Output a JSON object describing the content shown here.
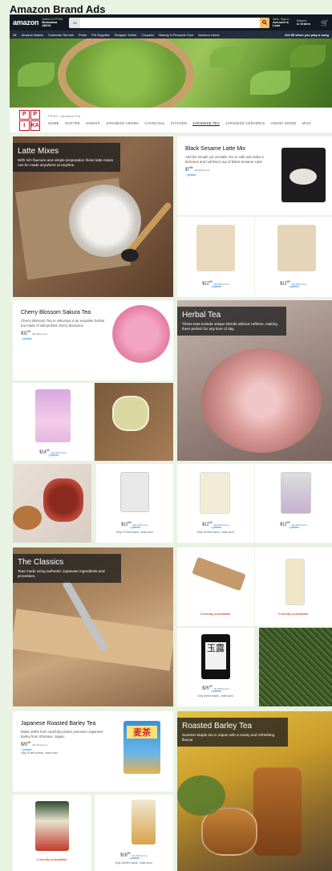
{
  "page_title": "Amazon Brand Ads",
  "header": {
    "logo": "amazon",
    "deliver_line1": "Deliver to PPIKA",
    "deliver_line2": "Botswana 48616",
    "search_dept": "All",
    "search_placeholder": "",
    "account_line1": "Hello, Sign in",
    "account_line2": "Account & Lists",
    "orders_line1": "Returns",
    "orders_line2": "& Orders"
  },
  "nav": {
    "items": [
      "All",
      "Amazon Basics",
      "Customer Service",
      "Prime",
      "Pet Supplies",
      "Shopper Toolkit",
      "Coupons",
      "Beauty & Personal Care",
      "Amazon Home"
    ],
    "promo": "Get $5 when you play a song"
  },
  "brand": {
    "logo_letters": [
      "P",
      "P",
      "I",
      "KA"
    ],
    "breadcrumb": "PPIKA › Japanese Tea",
    "tabs": [
      "HOME",
      "GOSTEE",
      "HAWAIP",
      "JAPANESE AROMA",
      "CHARCOAL",
      "KITCHEN",
      "JAPANESE TEA",
      "JAPANESE CERAMICS",
      "HINOKI WOOD",
      "MISC"
    ],
    "active_tab": 6
  },
  "sections": {
    "latte": {
      "title": "Latte Mixes",
      "desc": "With rich flavours and simple preparation these latte mixes can be made anywhere at anytime."
    },
    "herbal": {
      "title": "Herbal Tea",
      "desc": "These teas include unique blends without caffeine, making them perfect for any time of day."
    },
    "classics": {
      "title": "The Classics",
      "desc": "Teas made using authentic Japanese ingredients and processes."
    },
    "roasted": {
      "title": "Roasted Barley Tea",
      "desc": "Summer-staple tea in Japan with a roasty and refreshing flavour"
    }
  },
  "products": {
    "black_sesame": {
      "title": "Black Sesame Latte Mix",
      "desc": "Add the simple yet versatile mix to milk and make a delicious and nutritious cup of Black Sesame Latte",
      "price": "$7",
      "cents": "99",
      "unit": "($0.99/Ounce)",
      "prime": "✓prime"
    },
    "latte_pouch_1": {
      "price": "$12",
      "cents": "99",
      "unit": "($3.25/Ounce)",
      "prime": "✓prime"
    },
    "latte_pouch_2": {
      "price": "$12",
      "cents": "99",
      "unit": "($3.25/Ounce)",
      "prime": "✓prime"
    },
    "sakura": {
      "title": "Cherry Blossom Sakura Tea",
      "desc": "Cherry Blossom Tea or sakurayu is an exquisite herbal tea made of salt-pickled cherry blossoms.",
      "price": "$11",
      "cents": "99",
      "unit": "($9.60/Ounce)",
      "prime": "✓prime"
    },
    "herbal_can": {
      "price": "$14",
      "cents": "99",
      "unit": "($5.00/Ounce)",
      "prime": "✓prime"
    },
    "herbal_bag_1": {
      "price": "$12",
      "cents": "99",
      "unit": "($3.25/Ounce)",
      "prime": "✓prime",
      "stock": "Only 17 left in stock - order soon."
    },
    "herbal_bag_2": {
      "price": "$12",
      "cents": "99",
      "unit": "($3.25/Ounce)",
      "prime": "✓prime",
      "stock": "Only 20 left in stock - order soon."
    },
    "herbal_bag_3": {
      "price": "$12",
      "cents": "99",
      "unit": "($3.25/Ounce)",
      "prime": "✓prime"
    },
    "classic_1": {
      "status": "Currently unavailable."
    },
    "classic_2": {
      "status": "Currently unavailable."
    },
    "gyokuro": {
      "label": "玉露",
      "price": "$26",
      "cents": "99",
      "unit": "($7.50/Ounce)",
      "prime": "✓prime",
      "stock": "Only 8 left in stock - order soon."
    },
    "barley": {
      "title": "Japanese Roasted Barley Tea",
      "desc": "Made 100% from carefully-picked, premium Japanese barley from Shimane, Japan.",
      "label": "麦茶",
      "price": "$20",
      "cents": "99",
      "unit": "($1.60/Ounce)",
      "prime": "✓prime",
      "stock": "Only 10 left in stock - order soon."
    },
    "barley_box_1": {
      "status": "Currently unavailable."
    },
    "barley_box_2": {
      "price": "$18",
      "cents": "99",
      "unit": "($1.50/Ounce)",
      "prime": "✓prime",
      "stock": "Only 18 left in stock - order soon."
    }
  },
  "colors": {
    "bg": "#e9f3e3",
    "amazon_dark": "#131921",
    "amazon_nav": "#232f3e",
    "search_button": "#febd69",
    "prime_blue": "#1a98ff",
    "unavailable_red": "#b12704"
  }
}
